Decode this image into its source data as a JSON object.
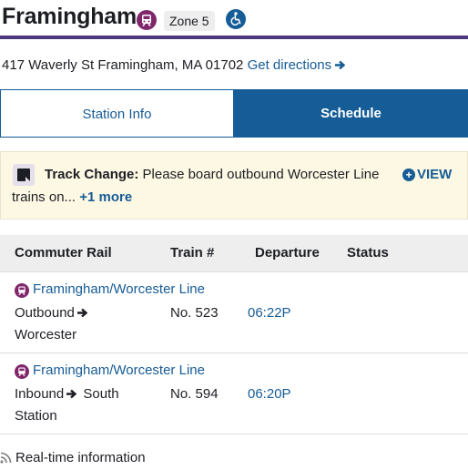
{
  "station": {
    "name": "Framingham",
    "zone": "Zone 5",
    "address": "417 Waverly St Framingham, MA 01702",
    "directions_label": "Get directions"
  },
  "tabs": [
    {
      "label": "Station Info",
      "active": false
    },
    {
      "label": "Schedule",
      "active": true
    }
  ],
  "alert": {
    "effect": "Track Change:",
    "text_line1": "Please board outbound Worcester Line",
    "text_line2": "trains on...",
    "more_label": "+1 more",
    "view_label": "VIEW"
  },
  "table": {
    "headers": [
      "Commuter Rail",
      "Train #",
      "Departure",
      "Status"
    ],
    "rows": [
      {
        "route": "Framingham/Worcester Line",
        "direction": "Outbound",
        "destination": "Worcester",
        "train": "No. 523",
        "departure": "06:22P",
        "status": ""
      },
      {
        "route": "Framingham/Worcester Line",
        "direction": "Inbound",
        "destination": "South Station",
        "train": "No. 594",
        "departure": "06:20P",
        "status": ""
      }
    ]
  },
  "footer": {
    "realtime_label": "Real-time information"
  },
  "colors": {
    "commuter_rail": "#80276c",
    "link": "#165c96",
    "header_rule": "#4c3a7c",
    "alert_bg": "#fdf8e3"
  },
  "icons": [
    "commuter-rail-icon",
    "accessible-icon",
    "arrow-right-icon",
    "alert-document-icon",
    "plus-circle-icon",
    "realtime-icon"
  ]
}
